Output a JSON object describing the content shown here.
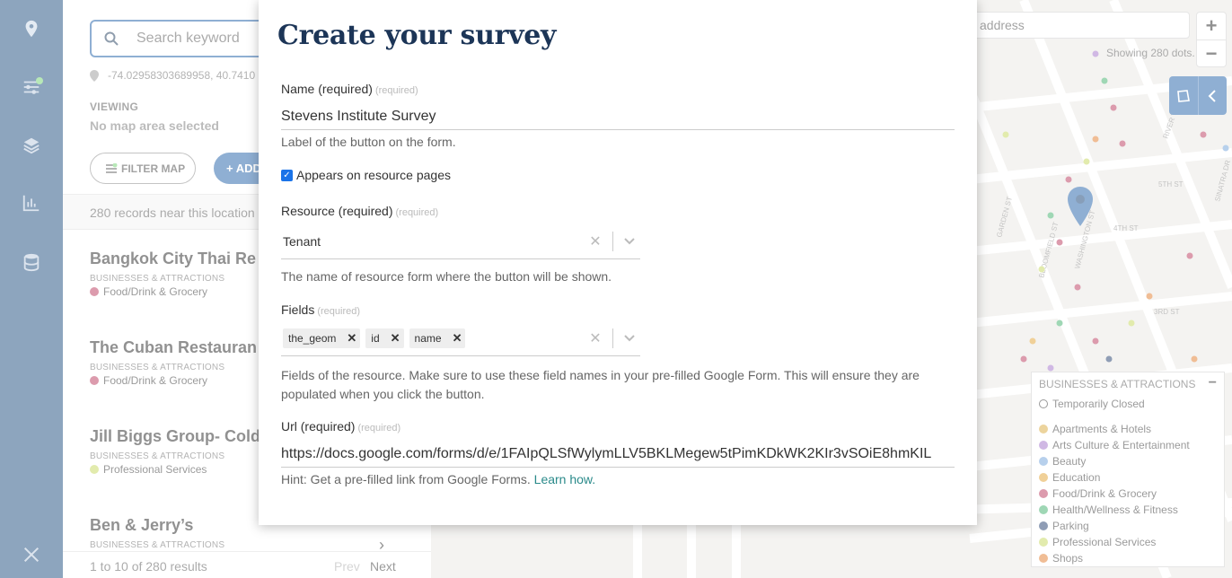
{
  "rail": {
    "icons": [
      "map-pin-icon",
      "sliders-icon",
      "layers-icon",
      "chart-icon",
      "database-icon",
      "tools-icon"
    ]
  },
  "panel": {
    "search_placeholder": "Search keyword",
    "coords": "-74.02958303689958, 40.7410",
    "viewing_label": "VIEWING",
    "viewing_value": "No map area selected",
    "filter_label": "FILTER MAP",
    "add_label": "+ ADD",
    "records_text": "280 records near this location",
    "items": [
      {
        "title": "Bangkok City Thai Re",
        "category": "BUSINESSES & ATTRACTIONS",
        "sub": "Food/Drink & Grocery",
        "color": "#b8365a"
      },
      {
        "title": "The Cuban Restauran",
        "category": "BUSINESSES & ATTRACTIONS",
        "sub": "Food/Drink & Grocery",
        "color": "#b8365a"
      },
      {
        "title": "Jill Biggs Group- Coldv",
        "category": "BUSINESSES & ATTRACTIONS",
        "sub": "Professional Services",
        "color": "#c4d65a"
      },
      {
        "title": "Ben & Jerry’s",
        "category": "BUSINESSES & ATTRACTIONS",
        "sub": "",
        "color": ""
      }
    ],
    "pager": {
      "range": "1 to 10 of 280 results",
      "prev": "Prev",
      "next": "Next"
    }
  },
  "map": {
    "address_placeholder": "address",
    "zoom_in": "+",
    "zoom_out": "−",
    "dots_count": "Showing 280 dots.",
    "streets": [
      "5TH ST",
      "4TH ST",
      "3RD ST",
      "RIVER TER",
      "SINATRA DR",
      "GARDEN ST",
      "BLOOMFIELD ST",
      "WASHINGTON ST"
    ],
    "legend": {
      "title": "BUSINESSES & ATTRACTIONS",
      "collapse": "−",
      "closed_label": "Temporarily Closed",
      "entries": [
        {
          "label": "Apartments & Hotels",
          "color": "#d9a83a"
        },
        {
          "label": "Arts Culture & Entertainment",
          "color": "#a070c8"
        },
        {
          "label": "Beauty",
          "color": "#6fa0d8"
        },
        {
          "label": "Education",
          "color": "#e0a030"
        },
        {
          "label": "Food/Drink & Grocery",
          "color": "#b8365a"
        },
        {
          "label": "Health/Wellness & Fitness",
          "color": "#3fae6a"
        },
        {
          "label": "Parking",
          "color": "#1f3b6a"
        },
        {
          "label": "Professional Services",
          "color": "#c4d65a"
        },
        {
          "label": "Shops",
          "color": "#e07a2a"
        }
      ]
    }
  },
  "modal": {
    "title": "Create your survey",
    "required_tag": "(required)",
    "name_label": "Name (required)",
    "name_value": "Stevens Institute Survey",
    "name_hint": "Label of the button on the form.",
    "appears_label": "Appears on resource pages",
    "resource_label": "Resource (required)",
    "resource_value": "Tenant",
    "resource_hint": "The name of resource form where the button will be shown.",
    "fields_label": "Fields",
    "fields_chips": [
      "the_geom",
      "id",
      "name"
    ],
    "fields_hint": "Fields of the resource. Make sure to use these field names in your pre-filled Google Form. This will ensure they are populated when you click the button.",
    "url_label": "Url (required)",
    "url_value": "https://docs.google.com/forms/d/e/1FAIpQLSfWylymLLV5BKLMegew5tPimKDkWK2KIr3vSOiE8hmKIL",
    "url_hint": "Hint: Get a pre-filled link from Google Forms.",
    "url_hint_link": "Learn how."
  }
}
